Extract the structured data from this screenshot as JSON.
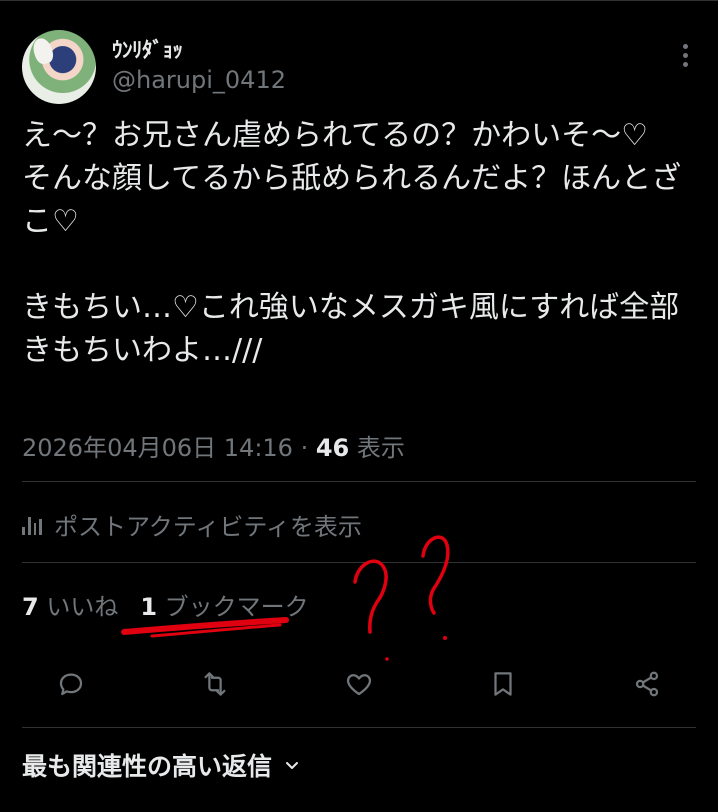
{
  "author": {
    "display_name": "ｳﾝﾘﾀﾞｮｯ",
    "handle": "@harupi_0412"
  },
  "tweet": {
    "text": "え〜？お兄さん虐められてるの？かわいそ〜♡\nそんな顔してるから舐められるんだよ？ほんとざこ♡\n\nきもちい…♡これ強いなメスガキ風にすれば全部きもちいわよ…///",
    "timestamp": "2026年04月06日 14:16",
    "separator": " · ",
    "views_count": "46",
    "views_label": " 表示"
  },
  "activity_link": "ポストアクティビティを表示",
  "stats": {
    "likes_count": "7",
    "likes_label": " いいね",
    "bookmarks_count": "1",
    "bookmarks_label": " ブックマーク"
  },
  "actions": [
    "reply-icon",
    "retweet-icon",
    "like-icon",
    "bookmark-icon",
    "share-icon"
  ],
  "replies_sort": "最も関連性の高い返信",
  "colors": {
    "background": "#000000",
    "text": "#e7e9ea",
    "muted": "#71767b",
    "divider": "#2f3336",
    "annotation": "#e0000f"
  }
}
